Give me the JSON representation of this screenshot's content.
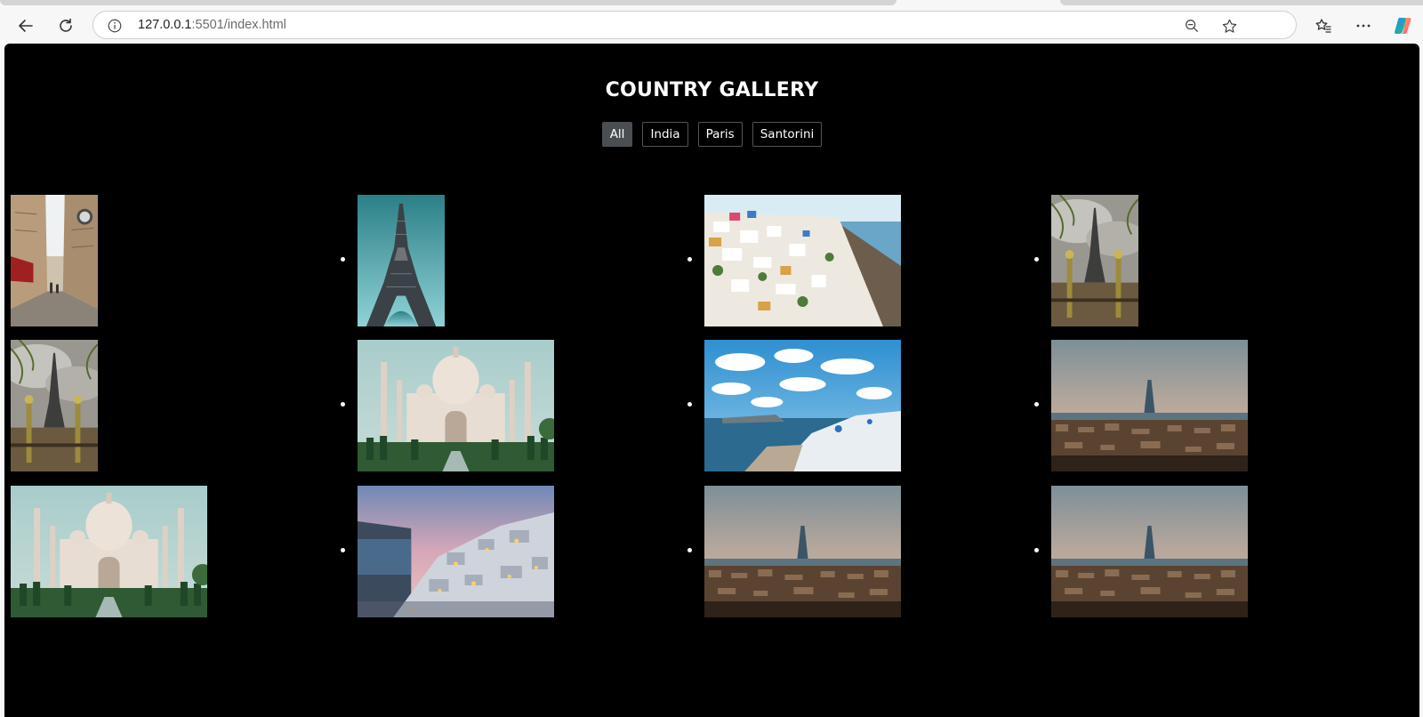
{
  "browser": {
    "url_host": "127.0.0.1",
    "url_rest": ":5501/index.html",
    "icons": [
      "back-arrow-icon",
      "refresh-icon",
      "info-icon",
      "zoom-out-icon",
      "favorite-star-icon",
      "favorites-icon",
      "more-icon",
      "copilot-icon"
    ]
  },
  "page": {
    "title": "COUNTRY GALLERY",
    "filters": [
      {
        "label": "All",
        "active": true
      },
      {
        "label": "India",
        "active": false
      },
      {
        "label": "Paris",
        "active": false
      },
      {
        "label": "Santorini",
        "active": false
      }
    ],
    "gallery": [
      [
        {
          "subject": "paris-street"
        },
        {
          "subject": "eiffel-tower-sky"
        },
        {
          "subject": "santorini-village"
        },
        {
          "subject": "eiffel-tower-garden"
        }
      ],
      [
        {
          "subject": "eiffel-tower-garden"
        },
        {
          "subject": "taj-mahal"
        },
        {
          "subject": "santorini-sea-clouds"
        },
        {
          "subject": "paris-skyline"
        }
      ],
      [
        {
          "subject": "taj-mahal"
        },
        {
          "subject": "santorini-dusk"
        },
        {
          "subject": "paris-skyline"
        },
        {
          "subject": "paris-skyline"
        }
      ]
    ]
  }
}
